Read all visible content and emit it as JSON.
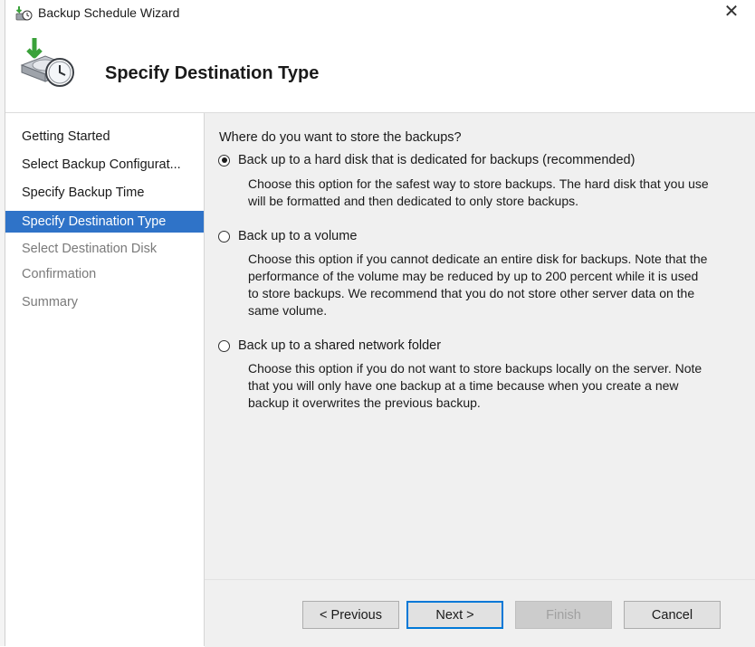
{
  "window": {
    "title": "Backup Schedule Wizard",
    "close_glyph": "✕"
  },
  "header": {
    "page_title": "Specify Destination Type",
    "icon": "backup-schedule-icon"
  },
  "sidebar": {
    "items": [
      {
        "label": "Getting Started",
        "state": "done"
      },
      {
        "label": "Select Backup Configurat...",
        "state": "done"
      },
      {
        "label": "Specify Backup Time",
        "state": "done"
      },
      {
        "label": "Specify Destination Type",
        "state": "active"
      },
      {
        "label": "Select Destination Disk",
        "state": "disabled"
      },
      {
        "label": "Confirmation",
        "state": "disabled"
      },
      {
        "label": "Summary",
        "state": "disabled"
      }
    ]
  },
  "main": {
    "question": "Where do you want to store the backups?",
    "options": [
      {
        "label": "Back up to a hard disk that is dedicated for backups (recommended)",
        "checked": true,
        "description_lines": [
          "Choose this option for the safest way to store backups. The hard disk that you use",
          "will be formatted and then dedicated to only store backups."
        ]
      },
      {
        "label": "Back up to a volume",
        "checked": false,
        "description_lines": [
          "Choose this option if you cannot dedicate an entire disk for backups. Note that the",
          "performance of the volume may be reduced by up to 200 percent while it is used",
          "to store backups. We recommend that you do not store other server data on the",
          "same volume."
        ]
      },
      {
        "label": "Back up to a shared network folder",
        "checked": false,
        "description_lines": [
          "Choose this option if you do not want to store backups locally on the server. Note",
          "that you will only have one backup at a time because when you create a new",
          "backup it overwrites the previous backup."
        ]
      }
    ]
  },
  "footer": {
    "previous_label": "< Previous",
    "next_label": "Next >",
    "finish_label": "Finish",
    "cancel_label": "Cancel"
  },
  "colors": {
    "active_nav": "#2f73c8",
    "content_bg": "#f0f0f0",
    "default_button_border": "#0078d7"
  }
}
